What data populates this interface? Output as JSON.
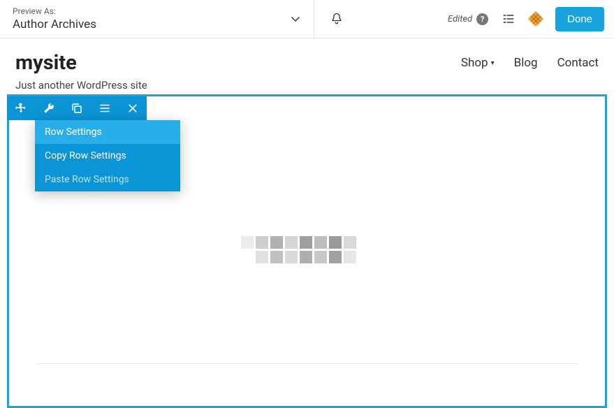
{
  "topbar": {
    "preview_label": "Preview As:",
    "preview_value": "Author Archives",
    "edited_label": "Edited",
    "done_label": "Done"
  },
  "header": {
    "site_title": "mysite",
    "tagline": "Just another WordPress site",
    "nav": [
      {
        "label": "Shop",
        "has_children": true
      },
      {
        "label": "Blog",
        "has_children": false
      },
      {
        "label": "Contact",
        "has_children": false
      }
    ]
  },
  "toolbar_dropdown": {
    "items": [
      {
        "label": "Row Settings",
        "state": "highlight"
      },
      {
        "label": "Copy Row Settings",
        "state": "normal"
      },
      {
        "label": "Paste Row Settings",
        "state": "disabled"
      }
    ]
  },
  "colors": {
    "accent": "#19a3dd",
    "toolbar": "#0b95d6",
    "waffle": "#e8a13b"
  }
}
